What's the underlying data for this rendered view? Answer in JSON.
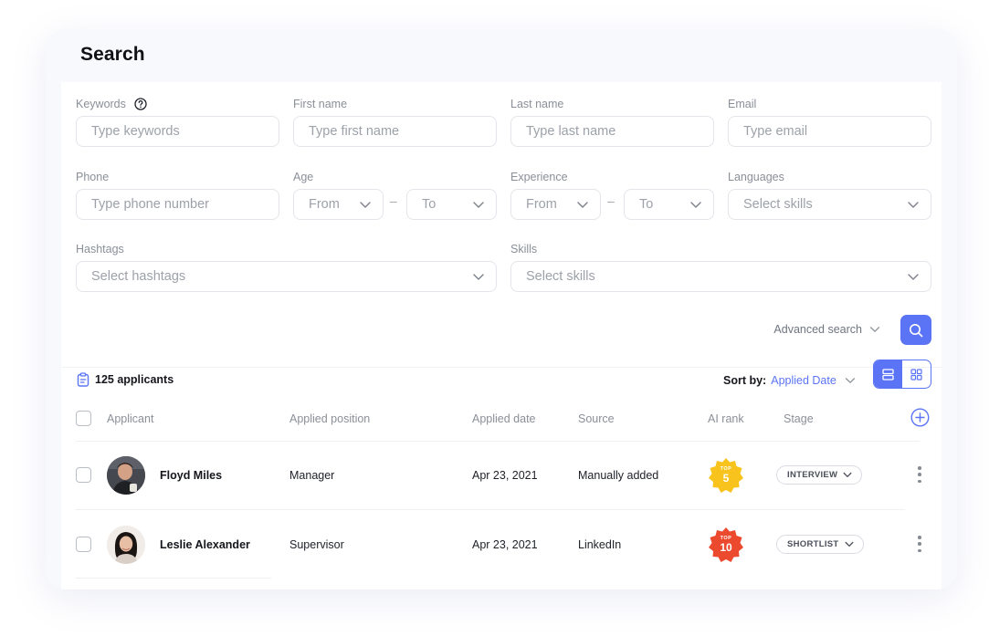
{
  "page": {
    "title": "Search"
  },
  "filters": {
    "keywords": {
      "label": "Keywords",
      "placeholder": "Type keywords"
    },
    "first_name": {
      "label": "First name",
      "placeholder": "Type first name"
    },
    "last_name": {
      "label": "Last name",
      "placeholder": "Type last name"
    },
    "email": {
      "label": "Email",
      "placeholder": "Type email"
    },
    "phone": {
      "label": "Phone",
      "placeholder": "Type phone number"
    },
    "age": {
      "label": "Age",
      "from": "From",
      "to": "To",
      "separator": "–"
    },
    "experience": {
      "label": "Experience",
      "from": "From",
      "to": "To",
      "separator": "–"
    },
    "languages": {
      "label": "Languages",
      "placeholder": "Select skills"
    },
    "hashtags": {
      "label": "Hashtags",
      "placeholder": "Select hashtags"
    },
    "skills": {
      "label": "Skills",
      "placeholder": "Select skills"
    }
  },
  "actions": {
    "advanced_search": "Advanced search",
    "search_icon": "search-icon"
  },
  "results": {
    "count_label": "125 applicants",
    "sort_label": "Sort by:",
    "sort_value": "Applied Date",
    "view_modes": [
      "list",
      "grid"
    ],
    "active_view": "list"
  },
  "table": {
    "columns": [
      "Applicant",
      "Applied position",
      "Applied date",
      "Source",
      "AI rank",
      "Stage"
    ],
    "rows": [
      {
        "name": "Floyd Miles",
        "position": "Manager",
        "date": "Apr 23, 2021",
        "source": "Manually added",
        "rank_top": "TOP",
        "rank_value": "5",
        "rank_color": "#f7c31c",
        "stage": "INTERVIEW"
      },
      {
        "name": "Leslie Alexander",
        "position": "Supervisor",
        "date": "Apr 23, 2021",
        "source": "LinkedIn",
        "rank_top": "TOP",
        "rank_value": "10",
        "rank_color": "#ec4a2f",
        "stage": "SHORTLIST"
      }
    ]
  },
  "colors": {
    "accent": "#5b74f5",
    "muted_text": "#8a8f98",
    "border": "#e3e5ea"
  }
}
